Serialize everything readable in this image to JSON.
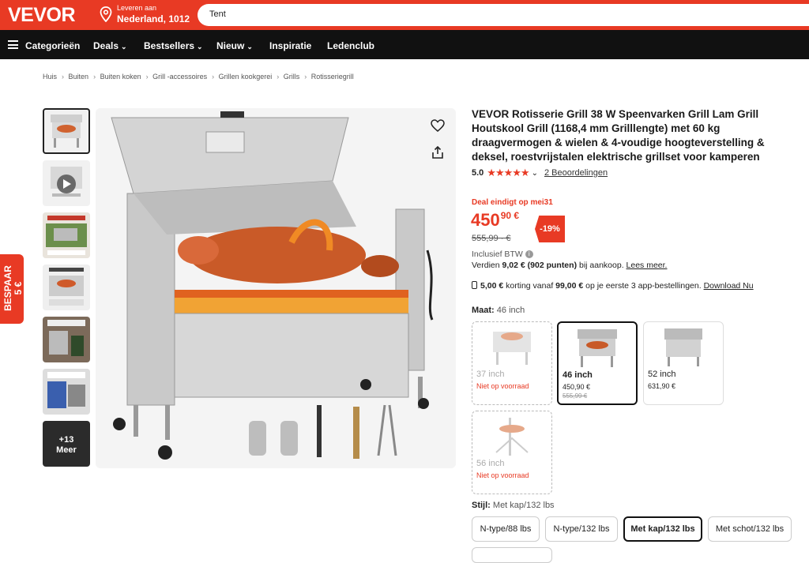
{
  "header": {
    "logo": "VEVOR",
    "deliver_label": "Leveren aan",
    "deliver_value": "Nederland, 1012",
    "search_value": "Tent"
  },
  "nav": {
    "menu": "Categorieën",
    "items": [
      "Deals",
      "Bestsellers",
      "Nieuw",
      "Inspiratie",
      "Ledenclub"
    ]
  },
  "breadcrumbs": [
    "Huis",
    "Buiten",
    "Buiten koken",
    "Grill -accessoires",
    "Grillen kookgerei",
    "Grills",
    "Rotisseriegrill"
  ],
  "side_tab": {
    "line1": "BESPAAR",
    "line2": "5 €"
  },
  "gallery": {
    "more_count": "+13",
    "more_label": "Meer"
  },
  "product": {
    "title": "VEVOR Rotisserie Grill 38 W Speenvarken Grill Lam Grill Houtskool Grill (1168,4 mm Grilllengte) met 60 kg draagvermogen & wielen & 4-voudige hoogteverstelling & deksel, roestvrijstalen elektrische grillset voor kamperen",
    "rating": "5.0",
    "stars": "★★★★★",
    "reviews": "2 Beoordelingen",
    "deal_text": "Deal eindigt op mei31",
    "price_int": "450",
    "price_cents": "90 €",
    "price_old": "555,99 · €",
    "discount": "-19%",
    "tax": "Inclusief BTW",
    "points_prefix": "Verdien ",
    "points_value": "9,02 € (902 punten)",
    "points_suffix": " bij aankoop. ",
    "points_link": "Lees meer.",
    "app_amount": "5,00 €",
    "app_text1": " korting vanaf ",
    "app_min": "99,00 €",
    "app_text2": " op je eerste 3 app-bestellingen. ",
    "app_link": "Download Nu"
  },
  "size": {
    "label": "Maat:",
    "value": "46 inch",
    "options": [
      {
        "name": "37 inch",
        "sub": "Niet op voorraad",
        "old": ""
      },
      {
        "name": "46 inch",
        "sub": "450,90 €",
        "old": "555,99 €"
      },
      {
        "name": "52 inch",
        "sub": "631,90 €",
        "old": ""
      },
      {
        "name": "56 inch",
        "sub": "Niet op voorraad",
        "old": ""
      }
    ]
  },
  "style": {
    "label": "Stijl:",
    "value": "Met kap/132 lbs",
    "options": [
      "N-type/88 lbs",
      "N-type/132 lbs",
      "Met kap/132 lbs",
      "Met schot/132 lbs"
    ]
  },
  "colors": {
    "brand": "#e83a24",
    "nav": "#111111"
  }
}
